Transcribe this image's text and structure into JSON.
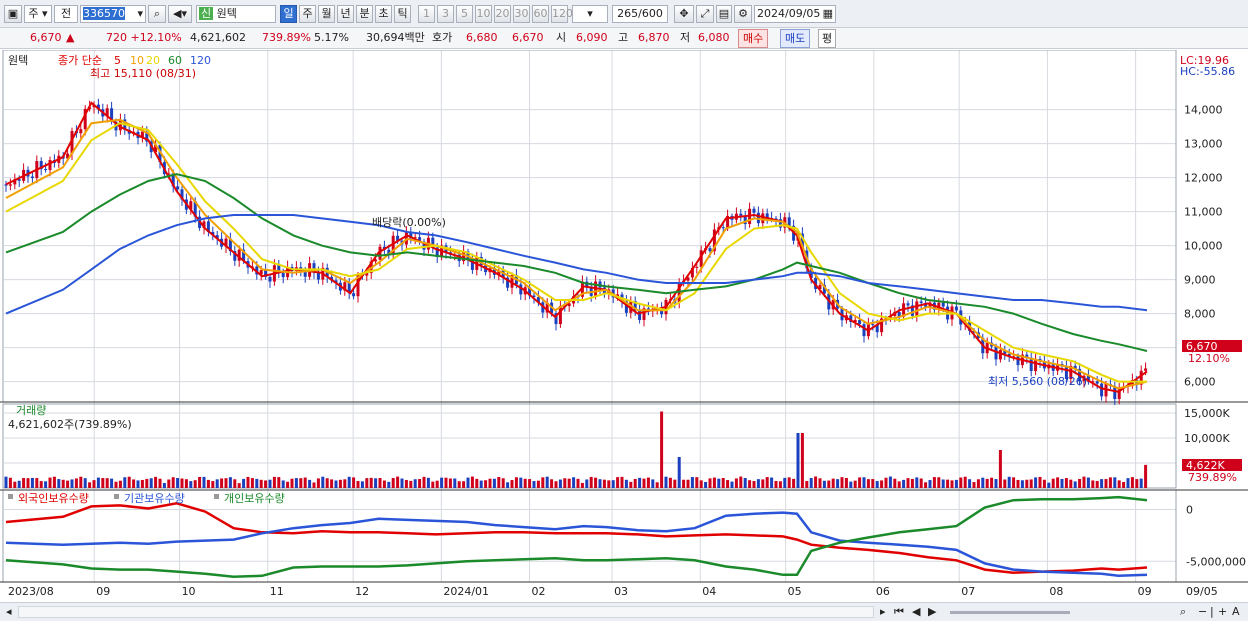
{
  "toolbar": {
    "period_labels": [
      "일",
      "주",
      "월",
      "년",
      "분",
      "초",
      "틱"
    ],
    "minute_labels": [
      "1",
      "3",
      "5",
      "10",
      "20",
      "30",
      "60",
      "120"
    ],
    "code_prefix": "주",
    "code_scope": "전",
    "stock_code": "336570",
    "stock_badge": "신",
    "stock_name": "원텍",
    "count": "265",
    "count_max": "/600",
    "date": "2024/09/05"
  },
  "quote": {
    "price": "6,670",
    "change": "720 +12.10%",
    "volume": "4,621,602",
    "volume_ratio": "739.89%",
    "turnover": "5.17%",
    "amount": "30,694백만",
    "quote_label": "호가",
    "ask": "6,680",
    "bid": "6,670",
    "open_label": "시",
    "open": "6,090",
    "high_label": "고",
    "high": "6,870",
    "low_label": "저",
    "low": "6,080",
    "buy_label": "매수",
    "sell_label": "매도",
    "flat_label": "평"
  },
  "legend": {
    "stock_name": "원텍",
    "ma_title": "종가 단순",
    "periods": [
      "5",
      "10",
      "20",
      "60",
      "120"
    ],
    "period_colors": [
      "#e00000",
      "#f0a000",
      "#e8d800",
      "#1a8a2a",
      "#2a55d8"
    ],
    "high_note": "최고 15,110 (08/31)",
    "low_note": "최저 5,560 (08/26)",
    "dividend_note": "배당락(0.00%)",
    "lc": "LC:19.96",
    "hc": "HC:-55.86"
  },
  "price_axis": [
    "14,000",
    "13,000",
    "12,000",
    "11,000",
    "10,000",
    "9,000",
    "8,000",
    "7,000",
    "6,000"
  ],
  "current_price_tag": "6,670",
  "current_change_tag": "12.10%",
  "volume_panel": {
    "title": "거래량",
    "value": "4,621,602주(739.89%)",
    "axis": [
      "15,000K",
      "10,000K",
      "5,000K"
    ],
    "tag_volume": "4,622K",
    "tag_ratio": "739.89%"
  },
  "holdings_panel": {
    "titles": [
      "외국인보유수량",
      "기관보유수량",
      "개인보유수량"
    ],
    "colors": [
      "#e00000",
      "#2a55d8",
      "#1a8a2a"
    ],
    "axis": [
      "0",
      "-5,000,000"
    ]
  },
  "x_axis": [
    "2023/08",
    "09",
    "10",
    "11",
    "12",
    "2024/01",
    "02",
    "03",
    "04",
    "05",
    "06",
    "07",
    "08",
    "09"
  ],
  "x_axis_end": "09/05",
  "colors": {
    "up": "#d0021b",
    "down": "#1a3fbf"
  },
  "chart_data": {
    "type": "line",
    "title": "원텍",
    "xlabel": "",
    "ylabel": "",
    "ylim": [
      5400,
      15400
    ],
    "grid": true,
    "legend": "top-left",
    "x": [
      "2023/08/01",
      "2023/08/21",
      "2023/08/31",
      "2023/09/10",
      "2023/09/20",
      "2023/09/30",
      "2023/10/10",
      "2023/10/20",
      "2023/10/30",
      "2023/11/10",
      "2023/11/20",
      "2023/11/30",
      "2023/12/10",
      "2023/12/20",
      "2023/12/30",
      "2024/01/10",
      "2024/01/20",
      "2024/01/30",
      "2024/02/10",
      "2024/02/20",
      "2024/02/28",
      "2024/03/10",
      "2024/03/20",
      "2024/03/30",
      "2024/04/10",
      "2024/04/20",
      "2024/04/30",
      "2024/05/05",
      "2024/05/10",
      "2024/05/20",
      "2024/05/30",
      "2024/06/10",
      "2024/06/20",
      "2024/06/30",
      "2024/07/10",
      "2024/07/20",
      "2024/07/30",
      "2024/08/10",
      "2024/08/20",
      "2024/08/26",
      "2024/09/05"
    ],
    "series": [
      {
        "name": "5",
        "values": [
          11800,
          12600,
          14200,
          13500,
          13100,
          11600,
          10500,
          9800,
          9100,
          9300,
          9200,
          8600,
          9800,
          10300,
          9900,
          9600,
          9200,
          8700,
          7900,
          8800,
          8700,
          8000,
          8200,
          9400,
          10800,
          10900,
          10700,
          10300,
          9000,
          8000,
          7500,
          8100,
          8300,
          8000,
          7000,
          6700,
          6500,
          6300,
          5800,
          5700,
          6300
        ]
      },
      {
        "name": "10",
        "values": [
          11400,
          12300,
          13600,
          13700,
          13300,
          12000,
          10900,
          10100,
          9300,
          9200,
          9300,
          8900,
          9500,
          10200,
          10000,
          9700,
          9300,
          8900,
          8100,
          8600,
          8700,
          8100,
          8100,
          9000,
          10500,
          10800,
          10700,
          10400,
          9300,
          8200,
          7700,
          7900,
          8200,
          8000,
          7200,
          6800,
          6600,
          6400,
          6000,
          5800,
          6000
        ]
      },
      {
        "name": "20",
        "values": [
          11000,
          11900,
          13100,
          13600,
          13400,
          12400,
          11300,
          10500,
          9600,
          9300,
          9300,
          9100,
          9300,
          9900,
          10000,
          9800,
          9400,
          9000,
          8400,
          8400,
          8600,
          8300,
          8100,
          8600,
          9900,
          10500,
          10600,
          10500,
          9800,
          8600,
          8000,
          7800,
          8000,
          8000,
          7500,
          7000,
          6800,
          6600,
          6200,
          6000,
          6000
        ]
      },
      {
        "name": "60",
        "values": [
          9800,
          10400,
          11000,
          11500,
          11900,
          12100,
          11900,
          11400,
          10800,
          10300,
          10000,
          9800,
          9700,
          9800,
          9700,
          9600,
          9500,
          9400,
          9200,
          8900,
          8800,
          8700,
          8600,
          8700,
          8800,
          9000,
          9300,
          9500,
          9400,
          9200,
          8900,
          8600,
          8400,
          8300,
          8200,
          8000,
          7700,
          7400,
          7200,
          7100,
          6900
        ]
      },
      {
        "name": "120",
        "values": [
          8000,
          8700,
          9300,
          9900,
          10300,
          10600,
          10800,
          10900,
          10900,
          10900,
          10800,
          10700,
          10600,
          10400,
          10300,
          10100,
          9900,
          9700,
          9500,
          9300,
          9200,
          9000,
          8900,
          8900,
          8900,
          9000,
          9100,
          9200,
          9200,
          9100,
          8900,
          8800,
          8700,
          8600,
          8500,
          8400,
          8400,
          8300,
          8200,
          8200,
          8100
        ]
      }
    ]
  }
}
